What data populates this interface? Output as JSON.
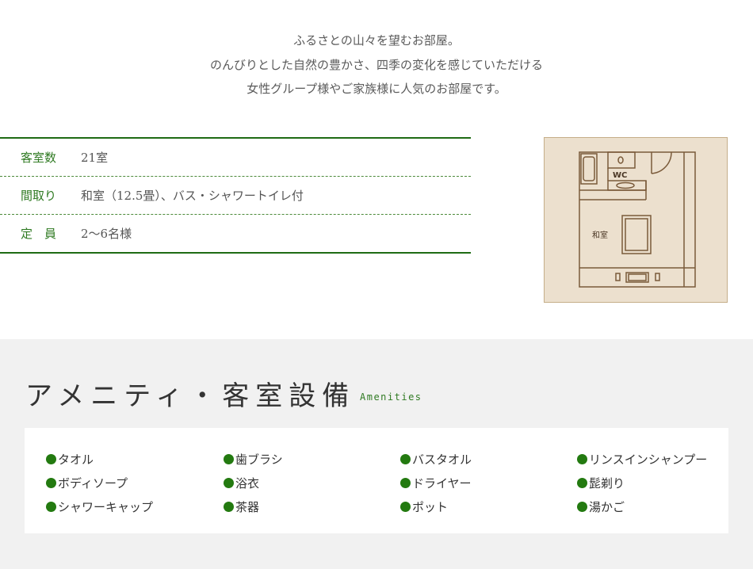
{
  "intro": {
    "lines": [
      "ふるさとの山々を望むお部屋。",
      "のんびりとした自然の豊かさ、四季の変化を感じていただける",
      "女性グループ様やご家族様に人気のお部屋です。"
    ]
  },
  "spec": {
    "rows": [
      {
        "label": "客室数",
        "value": "21室"
      },
      {
        "label": "間取り",
        "value": "和室（12.5畳）、バス・シャワートイレ付"
      },
      {
        "label": "定　員",
        "value": "2〜6名様"
      }
    ]
  },
  "floorplan": {
    "wc_label": "WC",
    "room_label": "和室"
  },
  "amenities": {
    "title": "アメニティ・客室設備",
    "subtitle": "Amenities",
    "columns": [
      [
        "タオル",
        "ボディソープ",
        "シャワーキャップ"
      ],
      [
        "歯ブラシ",
        "浴衣",
        "茶器"
      ],
      [
        "バスタオル",
        "ドライヤー",
        "ポット"
      ],
      [
        "リンスインシャンプー",
        "髭剃り",
        "湯かご"
      ]
    ]
  },
  "colors": {
    "accent_green": "#1e6b14",
    "floorplan_bg": "#ece0ce",
    "floorplan_line": "#7a5a3a",
    "section_bg": "#f1f1f1"
  }
}
